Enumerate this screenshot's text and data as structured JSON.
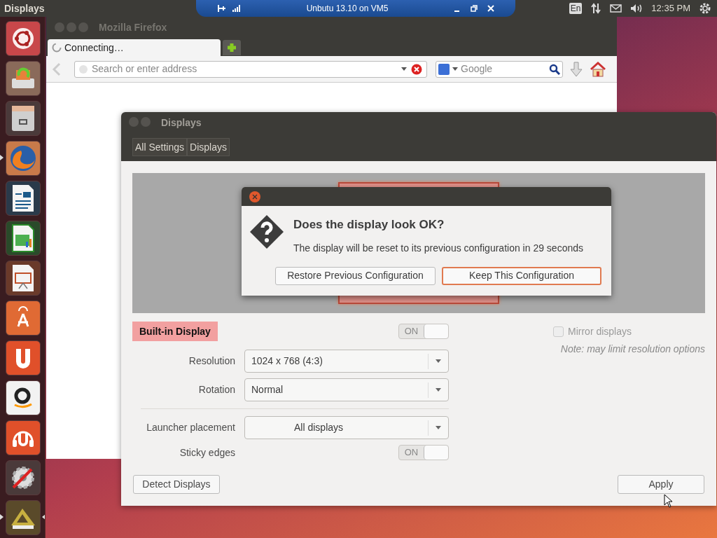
{
  "top_panel": {
    "app_title": "Displays",
    "vm_bar": {
      "title": "Unbutu 13.10 on VM5"
    },
    "keyboard": "En",
    "clock": "12:35 PM"
  },
  "launcher": [
    {
      "kind": "dash",
      "running": false,
      "focused": false
    },
    {
      "kind": "updater",
      "running": false,
      "focused": false
    },
    {
      "kind": "files",
      "running": false,
      "focused": false
    },
    {
      "kind": "browser",
      "running": true,
      "focused": false
    },
    {
      "kind": "writer",
      "running": false,
      "focused": false
    },
    {
      "kind": "calc",
      "running": false,
      "focused": false
    },
    {
      "kind": "impress",
      "running": false,
      "focused": false
    },
    {
      "kind": "store",
      "running": false,
      "focused": false
    },
    {
      "kind": "cloud",
      "running": false,
      "focused": false
    },
    {
      "kind": "shop",
      "running": false,
      "focused": false
    },
    {
      "kind": "music",
      "running": false,
      "focused": false
    },
    {
      "kind": "settings",
      "running": false,
      "focused": false
    },
    {
      "kind": "tools",
      "running": true,
      "focused": true
    }
  ],
  "firefox": {
    "title": "Mozilla Firefox",
    "tab": {
      "label": "Connecting…"
    },
    "address": {
      "placeholder": "Search or enter address"
    },
    "search": {
      "placeholder": "Google"
    }
  },
  "displays_window": {
    "title": "Displays",
    "breadcrumbs": [
      "All Settings",
      "Displays"
    ],
    "monitor": {
      "label": "Built-in Display",
      "on": true,
      "on_text": "ON"
    },
    "mirror": {
      "label": "Mirror displays",
      "checked": false,
      "disabled": true,
      "note": "Note: may limit resolution options"
    },
    "settings": [
      {
        "kind": "select",
        "label": "Resolution",
        "value": "1024 x 768 (4:3)",
        "centered": false
      },
      {
        "kind": "select",
        "label": "Rotation",
        "value": "Normal",
        "centered": false
      },
      {
        "kind": "divider"
      },
      {
        "kind": "select",
        "label": "Launcher placement",
        "value": "All displays",
        "centered": true
      },
      {
        "kind": "switch",
        "label": "Sticky edges",
        "on": true,
        "on_text": "ON"
      }
    ],
    "buttons": [
      {
        "label": "Detect Displays",
        "kind": "left"
      },
      {
        "label": "Apply",
        "kind": "right"
      }
    ]
  },
  "dialog": {
    "title": "Does the display look OK?",
    "message": "The display will be reset to its previous configuration in 29 seconds",
    "buttons": [
      {
        "label": "Restore Previous Configuration",
        "default": false
      },
      {
        "label": "Keep This Configuration",
        "default": true
      }
    ]
  }
}
